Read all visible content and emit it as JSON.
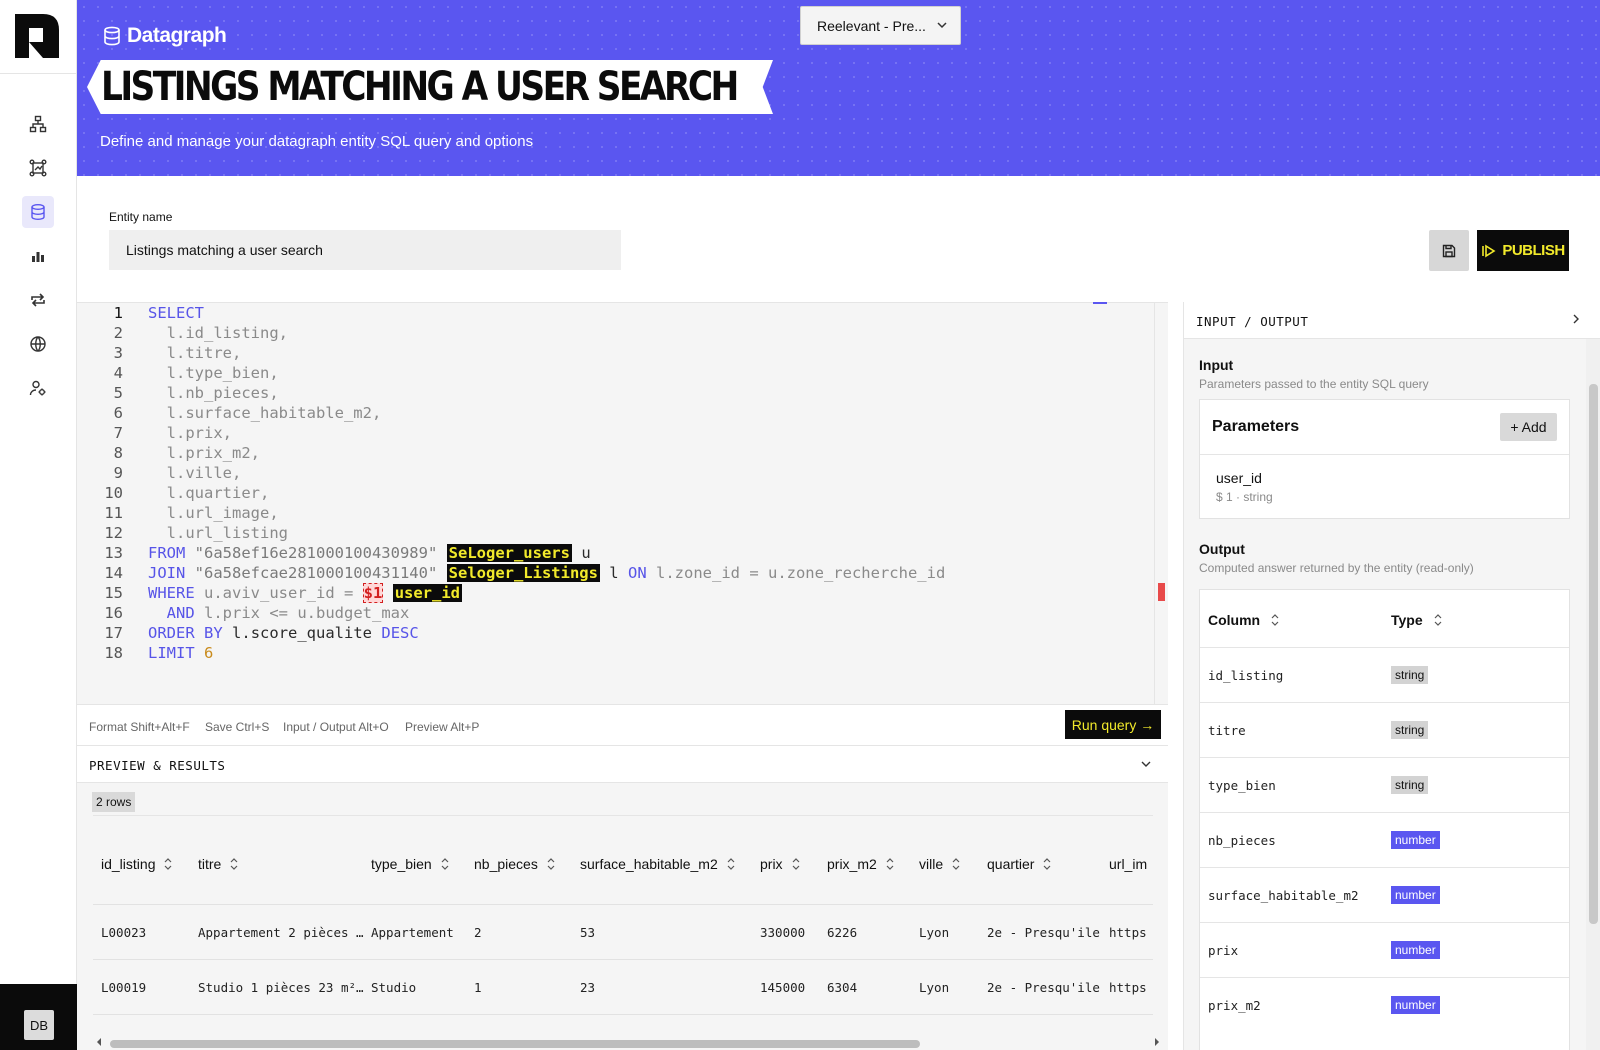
{
  "brand": {
    "name": "Datagraph"
  },
  "project_select": {
    "value": "Reelevant - Pre..."
  },
  "page": {
    "title": "LISTINGS MATCHING A USER SEARCH",
    "subtitle": "Define and manage your datagraph entity SQL query and options"
  },
  "entity": {
    "label": "Entity name",
    "value": "Listings matching a user search"
  },
  "actions": {
    "publish_label": "PUBLISH",
    "run_label": "Run query →"
  },
  "sidebar": {
    "items": [
      "graph",
      "entities",
      "datagraph",
      "analytics",
      "sync",
      "globe",
      "user-settings"
    ],
    "user_initials": "DB"
  },
  "editor": {
    "line_numbers": [
      "1",
      "2",
      "3",
      "4",
      "5",
      "6",
      "7",
      "8",
      "9",
      "10",
      "11",
      "12",
      "13",
      "14",
      "15",
      "16",
      "17",
      "18"
    ],
    "lines": {
      "l1_kw": "SELECT",
      "l2": "  l.id_listing,",
      "l3": "  l.titre,",
      "l4": "  l.type_bien,",
      "l5": "  l.nb_pieces,",
      "l6": "  l.surface_habitable_m2,",
      "l7": "  l.prix,",
      "l8": "  l.prix_m2,",
      "l9": "  l.ville,",
      "l10": "  l.quartier,",
      "l11": "  l.url_image,",
      "l12": "  l.url_listing",
      "l13_kw": "FROM",
      "l13_str": "\"6a58ef16e281000100430989\"",
      "l13_tag": "SeLoger_users",
      "l13_alias": " u",
      "l14_kw": "JOIN",
      "l14_str": "\"6a58efcae281000100431140\"",
      "l14_tag": "Seloger_Listings",
      "l14_alias": " l",
      "l14_on": "ON",
      "l14_rest": "l.zone_id = u.zone_recherche_id",
      "l15_kw": "WHERE",
      "l15_rest": "u.aviv_user_id =",
      "l15_param": "$1",
      "l15_tag": "user_id",
      "l16_kw": "AND",
      "l16_rest": "l.prix <= u.budget_max",
      "l17_kw1": "ORDER",
      "l17_kw2": "BY",
      "l17_rest": "l.score_qualite",
      "l17_kw3": "DESC",
      "l18_kw": "LIMIT",
      "l18_num": "6"
    }
  },
  "shortcuts": [
    "Format Shift+Alt+F",
    "Save Ctrl+S",
    "Input / Output Alt+O",
    "Preview Alt+P"
  ],
  "preview": {
    "title": "PREVIEW & RESULTS",
    "rows_badge": "2 rows",
    "columns": [
      "id_listing",
      "titre",
      "type_bien",
      "nb_pieces",
      "surface_habitable_m2",
      "prix",
      "prix_m2",
      "ville",
      "quartier",
      "url_im"
    ],
    "rows": [
      [
        "L00023",
        "Appartement 2 pièces …",
        "Appartement",
        "2",
        "53",
        "330000",
        "6226",
        "Lyon",
        "2e - Presqu'ile",
        "https"
      ],
      [
        "L00019",
        "Studio 1 pièces 23 m²…",
        "Studio",
        "1",
        "23",
        "145000",
        "6304",
        "Lyon",
        "2e - Presqu'ile",
        "https"
      ]
    ]
  },
  "io": {
    "title": "INPUT / OUTPUT",
    "input_title": "Input",
    "input_sub": "Parameters passed to the entity SQL query",
    "params_title": "Parameters",
    "add_label": "+ Add",
    "param": {
      "name": "user_id",
      "meta": "$ 1 · string"
    },
    "output_title": "Output",
    "output_sub": "Computed answer returned by the entity (read-only)",
    "col_header": "Column",
    "type_header": "Type",
    "outputs": [
      {
        "column": "id_listing",
        "type": "string"
      },
      {
        "column": "titre",
        "type": "string"
      },
      {
        "column": "type_bien",
        "type": "string"
      },
      {
        "column": "nb_pieces",
        "type": "number"
      },
      {
        "column": "surface_habitable_m2",
        "type": "number"
      },
      {
        "column": "prix",
        "type": "number"
      },
      {
        "column": "prix_m2",
        "type": "number"
      }
    ]
  },
  "colors": {
    "accent": "#5a56f0",
    "highlight": "#f2ea2b",
    "dark": "#0b0b0b",
    "error": "#e84a4a"
  }
}
